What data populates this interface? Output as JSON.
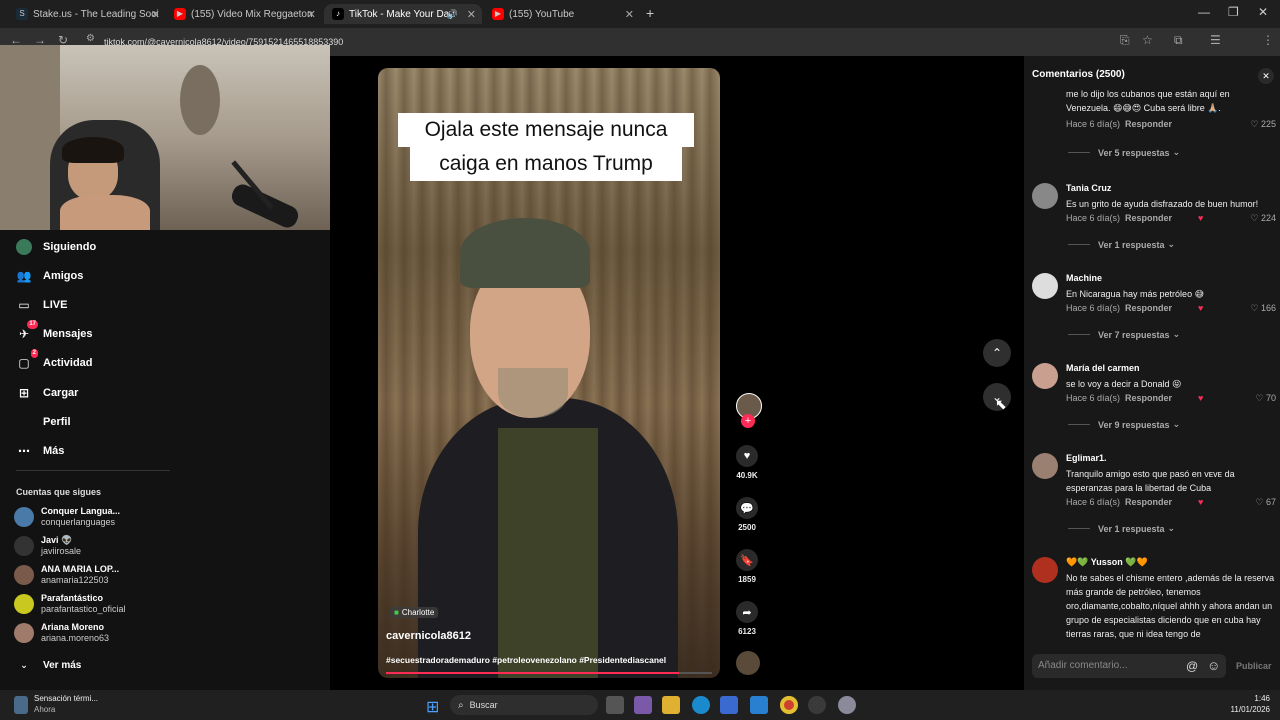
{
  "browser": {
    "tabs": [
      {
        "label": "Stake.us - The Leading Social C",
        "favicon": "S",
        "color": "#1a2c38"
      },
      {
        "label": "(155) Video Mix Reggaeton Vie",
        "favicon": "▶",
        "color": "#ff0000"
      },
      {
        "label": "TikTok - Make Your Day",
        "favicon": "♪",
        "color": "#000000"
      },
      {
        "label": "(155) YouTube",
        "favicon": "▶",
        "color": "#ff0000"
      }
    ],
    "url": "tiktok.com/@cavernicola8612/video/7591521465518853390"
  },
  "sidebar": {
    "items": [
      {
        "label": "Siguiendo",
        "icon": "following-icon"
      },
      {
        "label": "Amigos",
        "icon": "friends-icon"
      },
      {
        "label": "LIVE",
        "icon": "live-icon"
      },
      {
        "label": "Mensajes",
        "icon": "messages-icon",
        "badge": "17"
      },
      {
        "label": "Actividad",
        "icon": "activity-icon",
        "badge": "2"
      },
      {
        "label": "Cargar",
        "icon": "upload-icon"
      },
      {
        "label": "Perfil",
        "icon": "profile-icon"
      },
      {
        "label": "Más",
        "icon": "more-icon"
      }
    ],
    "following_title": "Cuentas que sigues",
    "following": [
      {
        "name": "Conquer Langua...",
        "handle": "conquerlanguages",
        "color": "#4a7aa8"
      },
      {
        "name": "Javi 👽",
        "handle": "javiirosale",
        "color": "#333333"
      },
      {
        "name": "ANA MARIA LOP...",
        "handle": "anamaria122503",
        "color": "#7a5a4a"
      },
      {
        "name": "Parafantástico",
        "handle": "parafantastico_oficial",
        "color": "#c8c820"
      },
      {
        "name": "Ariana Moreno",
        "handle": "ariana.moreno63",
        "color": "#a07a6a"
      }
    ],
    "see_more": "Ver más"
  },
  "video": {
    "caption_line1": "Ojala este mensaje nunca",
    "caption_line2": "caiga en manos  Trump",
    "sound_tag": "Charlotte",
    "author": "cavernicola8612",
    "hashtags": "#secuestradorademaduro #petroleovenezolano #Presidentediascanel",
    "progress": 0.9,
    "likes": "40.9K",
    "comments": "2500",
    "saves": "1859",
    "shares": "6123"
  },
  "comments_panel": {
    "title": "Comentarios (2500)",
    "input_placeholder": "Añadir comentario...",
    "post_label": "Publicar",
    "top_text": "me lo dijo los cubanos que están aquí en Venezuela. 😄😅😍 Cuba será libre 🙏🏼.",
    "top_meta": "Hace 6 día(s)",
    "top_reply": "Responder",
    "top_likes": "225",
    "top_view_replies": "Ver 5 respuestas",
    "items": [
      {
        "user": "Tania Cruz",
        "text": "Es un grito de ayuda disfrazado de buen humor!",
        "meta": "Hace 6 día(s)",
        "reply": "Responder",
        "likes": "224",
        "view_replies": "Ver 1 respuesta",
        "color": "#888888"
      },
      {
        "user": "Machine",
        "text": "En Nicaragua hay más petróleo 😅",
        "meta": "Hace 6 día(s)",
        "reply": "Responder",
        "likes": "166",
        "view_replies": "Ver 7 respuestas",
        "color": "#dddddd"
      },
      {
        "user": "María del carmen",
        "text": "se lo voy a decir a Donald 😝",
        "meta": "Hace 6 día(s)",
        "reply": "Responder",
        "likes": "70",
        "view_replies": "Ver 9 respuestas",
        "color": "#c9a090"
      },
      {
        "user": "Eglimar1.",
        "text": "Tranquilo amigo esto que pasó en ᴠᴇᴠᴇ da esperanzas para la libertad de Cuba",
        "meta": "Hace 6 día(s)",
        "reply": "Responder",
        "likes": "67",
        "view_replies": "Ver 1 respuesta",
        "color": "#9a8070"
      },
      {
        "user": "🧡💚 Yusson 💚🧡",
        "text": "No te sabes el chisme entero ,además de la reserva más grande de petróleo, tenemos oro,diamante,cobalto,níquel ahhh y ahora andan un grupo de especialistas diciendo que en cuba hay tierras raras, que ni idea tengo de",
        "color": "#b03020"
      }
    ]
  },
  "taskbar": {
    "weather_title": "Sensación térmi...",
    "weather_sub": "Ahora",
    "search_label": "Buscar",
    "time": "1:46",
    "date": "11/01/2026"
  }
}
